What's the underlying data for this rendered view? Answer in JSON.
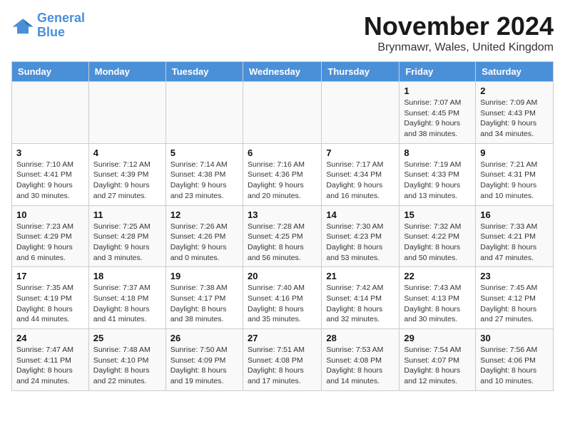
{
  "logo": {
    "line1": "General",
    "line2": "Blue"
  },
  "title": "November 2024",
  "location": "Brynmawr, Wales, United Kingdom",
  "weekdays": [
    "Sunday",
    "Monday",
    "Tuesday",
    "Wednesday",
    "Thursday",
    "Friday",
    "Saturday"
  ],
  "weeks": [
    [
      {
        "day": "",
        "info": ""
      },
      {
        "day": "",
        "info": ""
      },
      {
        "day": "",
        "info": ""
      },
      {
        "day": "",
        "info": ""
      },
      {
        "day": "",
        "info": ""
      },
      {
        "day": "1",
        "info": "Sunrise: 7:07 AM\nSunset: 4:45 PM\nDaylight: 9 hours and 38 minutes."
      },
      {
        "day": "2",
        "info": "Sunrise: 7:09 AM\nSunset: 4:43 PM\nDaylight: 9 hours and 34 minutes."
      }
    ],
    [
      {
        "day": "3",
        "info": "Sunrise: 7:10 AM\nSunset: 4:41 PM\nDaylight: 9 hours and 30 minutes."
      },
      {
        "day": "4",
        "info": "Sunrise: 7:12 AM\nSunset: 4:39 PM\nDaylight: 9 hours and 27 minutes."
      },
      {
        "day": "5",
        "info": "Sunrise: 7:14 AM\nSunset: 4:38 PM\nDaylight: 9 hours and 23 minutes."
      },
      {
        "day": "6",
        "info": "Sunrise: 7:16 AM\nSunset: 4:36 PM\nDaylight: 9 hours and 20 minutes."
      },
      {
        "day": "7",
        "info": "Sunrise: 7:17 AM\nSunset: 4:34 PM\nDaylight: 9 hours and 16 minutes."
      },
      {
        "day": "8",
        "info": "Sunrise: 7:19 AM\nSunset: 4:33 PM\nDaylight: 9 hours and 13 minutes."
      },
      {
        "day": "9",
        "info": "Sunrise: 7:21 AM\nSunset: 4:31 PM\nDaylight: 9 hours and 10 minutes."
      }
    ],
    [
      {
        "day": "10",
        "info": "Sunrise: 7:23 AM\nSunset: 4:29 PM\nDaylight: 9 hours and 6 minutes."
      },
      {
        "day": "11",
        "info": "Sunrise: 7:25 AM\nSunset: 4:28 PM\nDaylight: 9 hours and 3 minutes."
      },
      {
        "day": "12",
        "info": "Sunrise: 7:26 AM\nSunset: 4:26 PM\nDaylight: 9 hours and 0 minutes."
      },
      {
        "day": "13",
        "info": "Sunrise: 7:28 AM\nSunset: 4:25 PM\nDaylight: 8 hours and 56 minutes."
      },
      {
        "day": "14",
        "info": "Sunrise: 7:30 AM\nSunset: 4:23 PM\nDaylight: 8 hours and 53 minutes."
      },
      {
        "day": "15",
        "info": "Sunrise: 7:32 AM\nSunset: 4:22 PM\nDaylight: 8 hours and 50 minutes."
      },
      {
        "day": "16",
        "info": "Sunrise: 7:33 AM\nSunset: 4:21 PM\nDaylight: 8 hours and 47 minutes."
      }
    ],
    [
      {
        "day": "17",
        "info": "Sunrise: 7:35 AM\nSunset: 4:19 PM\nDaylight: 8 hours and 44 minutes."
      },
      {
        "day": "18",
        "info": "Sunrise: 7:37 AM\nSunset: 4:18 PM\nDaylight: 8 hours and 41 minutes."
      },
      {
        "day": "19",
        "info": "Sunrise: 7:38 AM\nSunset: 4:17 PM\nDaylight: 8 hours and 38 minutes."
      },
      {
        "day": "20",
        "info": "Sunrise: 7:40 AM\nSunset: 4:16 PM\nDaylight: 8 hours and 35 minutes."
      },
      {
        "day": "21",
        "info": "Sunrise: 7:42 AM\nSunset: 4:14 PM\nDaylight: 8 hours and 32 minutes."
      },
      {
        "day": "22",
        "info": "Sunrise: 7:43 AM\nSunset: 4:13 PM\nDaylight: 8 hours and 30 minutes."
      },
      {
        "day": "23",
        "info": "Sunrise: 7:45 AM\nSunset: 4:12 PM\nDaylight: 8 hours and 27 minutes."
      }
    ],
    [
      {
        "day": "24",
        "info": "Sunrise: 7:47 AM\nSunset: 4:11 PM\nDaylight: 8 hours and 24 minutes."
      },
      {
        "day": "25",
        "info": "Sunrise: 7:48 AM\nSunset: 4:10 PM\nDaylight: 8 hours and 22 minutes."
      },
      {
        "day": "26",
        "info": "Sunrise: 7:50 AM\nSunset: 4:09 PM\nDaylight: 8 hours and 19 minutes."
      },
      {
        "day": "27",
        "info": "Sunrise: 7:51 AM\nSunset: 4:08 PM\nDaylight: 8 hours and 17 minutes."
      },
      {
        "day": "28",
        "info": "Sunrise: 7:53 AM\nSunset: 4:08 PM\nDaylight: 8 hours and 14 minutes."
      },
      {
        "day": "29",
        "info": "Sunrise: 7:54 AM\nSunset: 4:07 PM\nDaylight: 8 hours and 12 minutes."
      },
      {
        "day": "30",
        "info": "Sunrise: 7:56 AM\nSunset: 4:06 PM\nDaylight: 8 hours and 10 minutes."
      }
    ]
  ]
}
